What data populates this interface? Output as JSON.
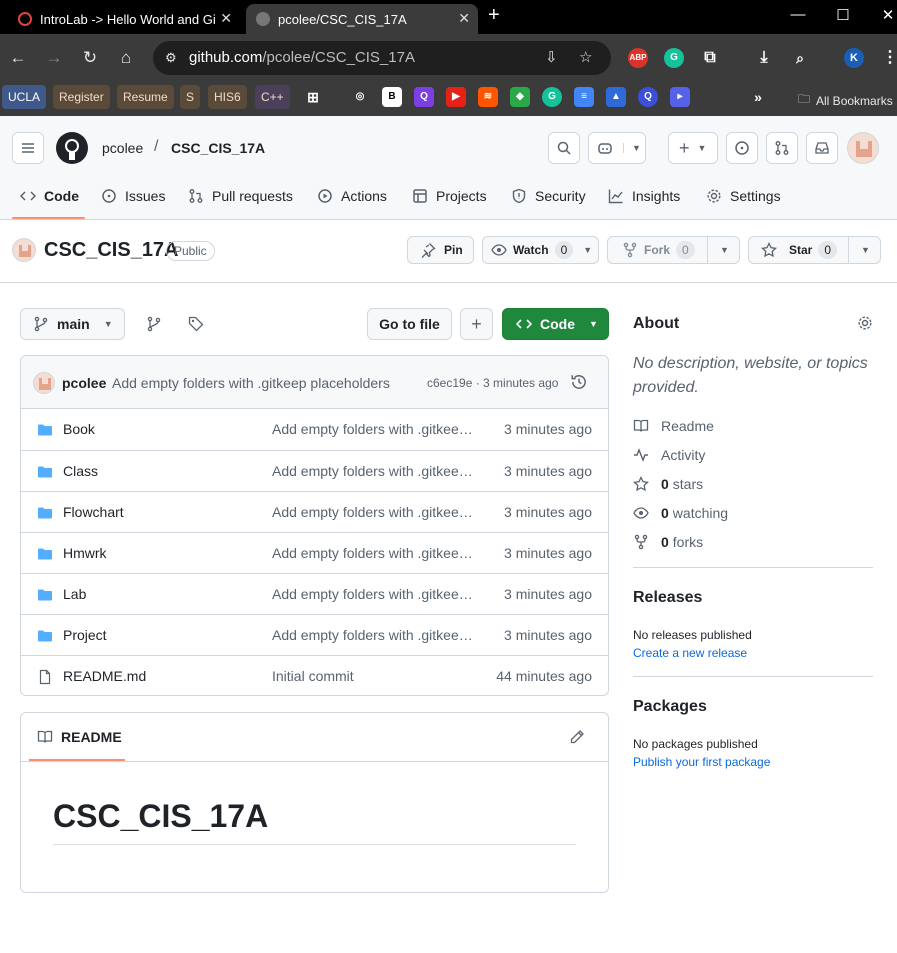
{
  "browser": {
    "tabs": [
      {
        "title": "IntroLab -> Hello World and Gi",
        "active": false
      },
      {
        "title": "pcolee/CSC_CIS_17A",
        "active": true
      }
    ],
    "new_tab": "+",
    "url_host": "github.com",
    "url_path": "/pcolee/CSC_CIS_17A",
    "profile_initial": "K",
    "bookmarks": [
      "UCLA",
      "Register",
      "Resume",
      "S",
      "HIS6",
      "C++"
    ],
    "all_bookmarks": "All Bookmarks",
    "extension_abp": "ABP"
  },
  "header": {
    "owner": "pcolee",
    "separator": "/",
    "repo": "CSC_CIS_17A",
    "plus": "+",
    "tabs": [
      "Code",
      "Issues",
      "Pull requests",
      "Actions",
      "Projects",
      "Security",
      "Insights",
      "Settings"
    ]
  },
  "repo": {
    "name": "CSC_CIS_17A",
    "visibility": "Public",
    "pin_label": "Pin",
    "watch_label": "Watch",
    "watch_count": "0",
    "fork_label": "Fork",
    "fork_count": "0",
    "star_label": "Star",
    "star_count": "0"
  },
  "filebar": {
    "branch": "main",
    "go_to_file": "Go to file",
    "add": "+",
    "code": "Code"
  },
  "commit": {
    "author": "pcolee",
    "message": "Add empty folders with .gitkeep placeholders",
    "sha_time": "c6ec19e · 3 minutes ago"
  },
  "files": [
    {
      "name": "Book",
      "message": "Add empty folders with .gitkeep placeholders",
      "age": "3 minutes ago",
      "type": "folder"
    },
    {
      "name": "Class",
      "message": "Add empty folders with .gitkeep placeholders",
      "age": "3 minutes ago",
      "type": "folder"
    },
    {
      "name": "Flowchart",
      "message": "Add empty folders with .gitkeep placeholders",
      "age": "3 minutes ago",
      "type": "folder"
    },
    {
      "name": "Hmwrk",
      "message": "Add empty folders with .gitkeep placeholders",
      "age": "3 minutes ago",
      "type": "folder"
    },
    {
      "name": "Lab",
      "message": "Add empty folders with .gitkeep placeholders",
      "age": "3 minutes ago",
      "type": "folder"
    },
    {
      "name": "Project",
      "message": "Add empty folders with .gitkeep placeholders",
      "age": "3 minutes ago",
      "type": "folder"
    },
    {
      "name": "README.md",
      "message": "Initial commit",
      "age": "44 minutes ago",
      "type": "file"
    }
  ],
  "readme": {
    "tab_label": "README",
    "heading": "CSC_CIS_17A"
  },
  "about": {
    "title": "About",
    "description": "No description, website, or topics provided.",
    "readme": "Readme",
    "activity": "Activity",
    "stars_count": "0",
    "stars_label": "stars",
    "watching_count": "0",
    "watching_label": "watching",
    "forks_count": "0",
    "forks_label": "forks"
  },
  "releases": {
    "title": "Releases",
    "none": "No releases published",
    "create_link": "Create a new release"
  },
  "packages": {
    "title": "Packages",
    "none": "No packages published",
    "publish_link": "Publish your first package"
  },
  "colors": {
    "primary_button": "#1f883d",
    "link": "#0969da",
    "folder": "#54aeff",
    "nav_underline": "#fd8c73"
  }
}
